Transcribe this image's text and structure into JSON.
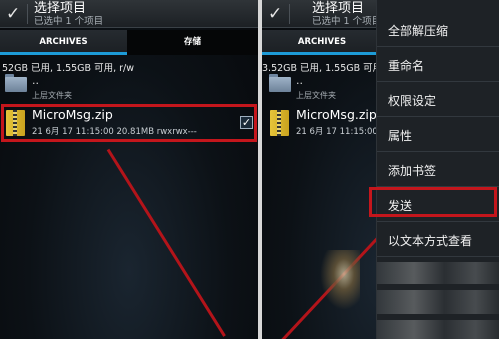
{
  "left": {
    "action_bar": {
      "title": "选择项目",
      "subtitle": "已选中 1 个项目"
    },
    "tabs": [
      {
        "label": "ARCHIVES"
      },
      {
        "label": "存储"
      }
    ],
    "storage_info": "52GB 已用, 1.55GB 可用, r/w",
    "parent": {
      "dots": "..",
      "label": "上层文件夹"
    },
    "file": {
      "name": "MicroMsg.zip",
      "meta": "21 6月 17 11:15:00  20.81MB  rwxrwx---",
      "checked": "✓"
    }
  },
  "right": {
    "action_bar": {
      "title": "选择项目",
      "subtitle": "已选中 1 个项目"
    },
    "tabs": [
      {
        "label": "ARCHIVES"
      }
    ],
    "storage_info": "3.52GB 已用, 1.55GB 可用",
    "parent": {
      "dots": "..",
      "label": "上层文件夹"
    },
    "file": {
      "name": "MicroMsg.zip",
      "meta": "21 6月 17 11:15:00  20.8"
    }
  },
  "context_menu": {
    "items": [
      {
        "label": "全部解压缩"
      },
      {
        "label": "重命名"
      },
      {
        "label": "权限设定"
      },
      {
        "label": "属性"
      },
      {
        "label": "添加书签"
      },
      {
        "label": "发送"
      },
      {
        "label": "以文本方式查看"
      }
    ]
  },
  "colors": {
    "accent": "#1d9bd7",
    "highlight": "#c4161c",
    "menu_bg": "#1e2226"
  },
  "icons": [
    "check-icon",
    "folder-icon",
    "zip-file-icon",
    "checkbox-icon"
  ]
}
